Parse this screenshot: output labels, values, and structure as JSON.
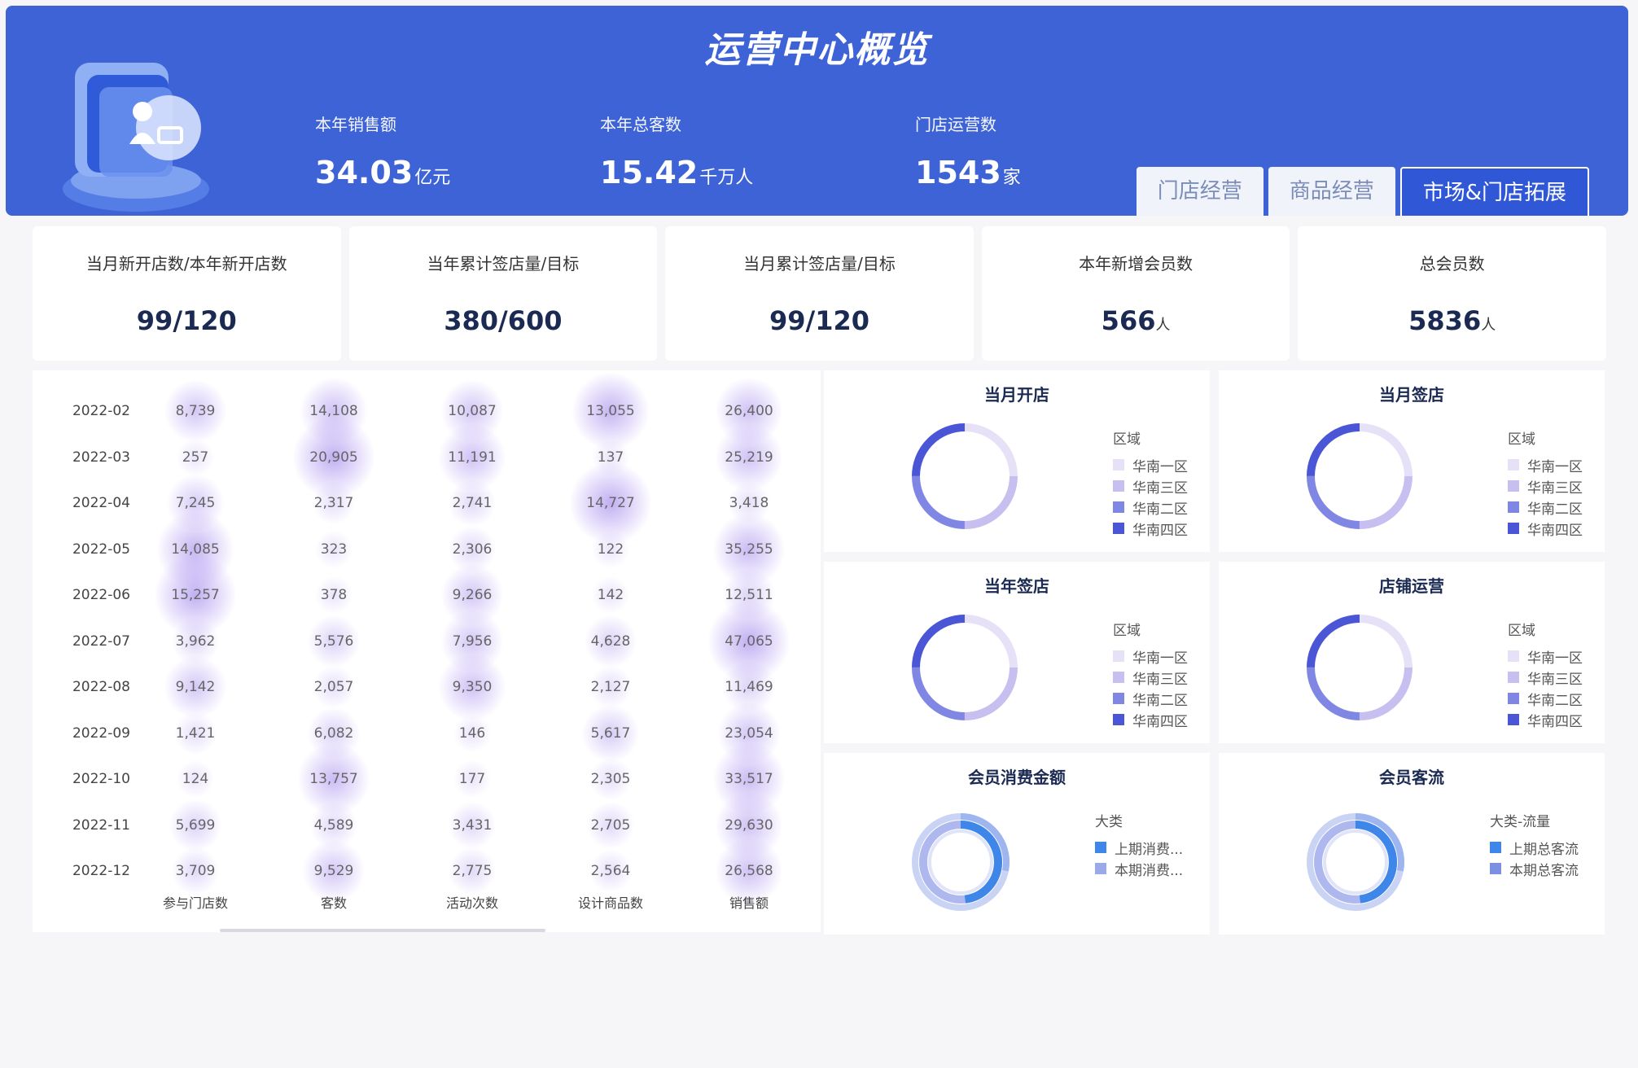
{
  "header": {
    "title": "运营中心概览",
    "kpis": [
      {
        "label": "本年销售额",
        "value": "34.03",
        "unit": "亿元"
      },
      {
        "label": "本年总客数",
        "value": "15.42",
        "unit": "千万人"
      },
      {
        "label": "门店运营数",
        "value": "1543",
        "unit": "家"
      }
    ],
    "tabs": [
      "门店经营",
      "商品经营",
      "市场&门店拓展"
    ],
    "active_tab": 2
  },
  "cards": [
    {
      "label": "当月新开店数/本年新开店数",
      "value": "99/120",
      "unit": ""
    },
    {
      "label": "当年累计签店量/目标",
      "value": "380/600",
      "unit": ""
    },
    {
      "label": "当月累计签店量/目标",
      "value": "99/120",
      "unit": ""
    },
    {
      "label": "本年新增会员数",
      "value": "566",
      "unit": "人"
    },
    {
      "label": "总会员数",
      "value": "5836",
      "unit": "人"
    }
  ],
  "table": {
    "columns": [
      "参与门店数",
      "客数",
      "活动次数",
      "设计商品数",
      "销售额"
    ],
    "rows": [
      {
        "date": "2022-02",
        "cells": [
          "8,739",
          "14,108",
          "10,087",
          "13,055",
          "26,400"
        ],
        "heat": [
          0.6,
          0.7,
          0.6,
          0.9,
          0.7
        ]
      },
      {
        "date": "2022-03",
        "cells": [
          "257",
          "20,905",
          "11,191",
          "137",
          "25,219"
        ],
        "heat": [
          0.1,
          1.0,
          0.7,
          0.1,
          0.7
        ]
      },
      {
        "date": "2022-04",
        "cells": [
          "7,245",
          "2,317",
          "2,741",
          "14,727",
          "3,418"
        ],
        "heat": [
          0.5,
          0.2,
          0.3,
          1.0,
          0.2
        ]
      },
      {
        "date": "2022-05",
        "cells": [
          "14,085",
          "323",
          "2,306",
          "122",
          "35,255"
        ],
        "heat": [
          0.9,
          0.1,
          0.3,
          0.1,
          0.8
        ]
      },
      {
        "date": "2022-06",
        "cells": [
          "15,257",
          "378",
          "9,266",
          "142",
          "12,511"
        ],
        "heat": [
          1.0,
          0.1,
          0.6,
          0.1,
          0.4
        ]
      },
      {
        "date": "2022-07",
        "cells": [
          "3,962",
          "5,576",
          "7,956",
          "4,628",
          "47,065"
        ],
        "heat": [
          0.3,
          0.4,
          0.6,
          0.4,
          1.0
        ]
      },
      {
        "date": "2022-08",
        "cells": [
          "9,142",
          "2,057",
          "9,350",
          "2,127",
          "11,469"
        ],
        "heat": [
          0.6,
          0.2,
          0.7,
          0.2,
          0.4
        ]
      },
      {
        "date": "2022-09",
        "cells": [
          "1,421",
          "6,082",
          "146",
          "5,617",
          "23,054"
        ],
        "heat": [
          0.2,
          0.4,
          0.1,
          0.5,
          0.6
        ]
      },
      {
        "date": "2022-10",
        "cells": [
          "124",
          "13,757",
          "177",
          "2,305",
          "33,517"
        ],
        "heat": [
          0.1,
          0.8,
          0.1,
          0.2,
          0.8
        ]
      },
      {
        "date": "2022-11",
        "cells": [
          "5,699",
          "4,589",
          "3,431",
          "2,705",
          "29,630"
        ],
        "heat": [
          0.4,
          0.3,
          0.3,
          0.3,
          0.7
        ]
      },
      {
        "date": "2022-12",
        "cells": [
          "3,709",
          "9,529",
          "2,775",
          "2,564",
          "26,568"
        ],
        "heat": [
          0.3,
          0.6,
          0.3,
          0.2,
          0.7
        ]
      }
    ]
  },
  "charts": [
    {
      "title": "当月开店",
      "legend_title": "区域",
      "type": "donut",
      "items": [
        {
          "name": "华南一区",
          "color": "#e7e1f7",
          "value": 25
        },
        {
          "name": "华南三区",
          "color": "#c7bff0",
          "value": 25
        },
        {
          "name": "华南二区",
          "color": "#7f86e3",
          "value": 25
        },
        {
          "name": "华南四区",
          "color": "#4a56d6",
          "value": 25
        }
      ]
    },
    {
      "title": "当月签店",
      "legend_title": "区域",
      "type": "donut",
      "items": [
        {
          "name": "华南一区",
          "color": "#e7e1f7",
          "value": 25
        },
        {
          "name": "华南三区",
          "color": "#c7bff0",
          "value": 25
        },
        {
          "name": "华南二区",
          "color": "#7f86e3",
          "value": 25
        },
        {
          "name": "华南四区",
          "color": "#4a56d6",
          "value": 25
        }
      ]
    },
    {
      "title": "当年签店",
      "legend_title": "区域",
      "type": "donut",
      "items": [
        {
          "name": "华南一区",
          "color": "#e7e1f7",
          "value": 25
        },
        {
          "name": "华南三区",
          "color": "#c7bff0",
          "value": 25
        },
        {
          "name": "华南二区",
          "color": "#7f86e3",
          "value": 25
        },
        {
          "name": "华南四区",
          "color": "#4a56d6",
          "value": 25
        }
      ]
    },
    {
      "title": "店铺运营",
      "legend_title": "区域",
      "type": "donut",
      "items": [
        {
          "name": "华南一区",
          "color": "#e7e1f7",
          "value": 25
        },
        {
          "name": "华南三区",
          "color": "#c7bff0",
          "value": 25
        },
        {
          "name": "华南二区",
          "color": "#7f86e3",
          "value": 25
        },
        {
          "name": "华南四区",
          "color": "#4a56d6",
          "value": 25
        }
      ]
    },
    {
      "title": "会员消费金额",
      "legend_title": "大类",
      "type": "double-donut",
      "items": [
        {
          "name": "上期消费...",
          "color": "#3e86e8",
          "value": 50
        },
        {
          "name": "本期消费...",
          "color": "#9aa9ea",
          "value": 50
        }
      ]
    },
    {
      "title": "会员客流",
      "legend_title": "大类-流量",
      "type": "double-donut",
      "items": [
        {
          "name": "上期总客流",
          "color": "#3e86e8",
          "value": 50
        },
        {
          "name": "本期总客流",
          "color": "#7c8fe3",
          "value": 50
        }
      ]
    }
  ]
}
